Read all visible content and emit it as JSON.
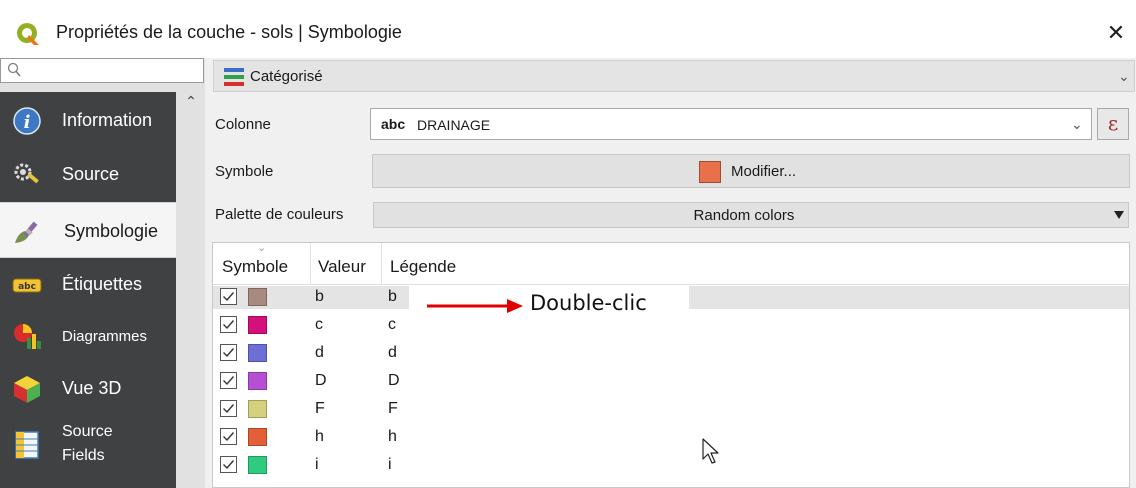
{
  "window": {
    "title": "Propriétés de la couche - sols | Symbologie",
    "close_glyph": "✕"
  },
  "sidebar": {
    "search_placeholder": "",
    "items": [
      {
        "label": "Information",
        "icon": "info-icon"
      },
      {
        "label": "Source",
        "icon": "source-wrench-icon"
      },
      {
        "label": "Symbologie",
        "icon": "paintbrush-icon",
        "selected": true
      },
      {
        "label": "Étiquettes",
        "icon": "abc-label-icon"
      },
      {
        "label": "Diagrammes",
        "icon": "pie-chart-icon"
      },
      {
        "label": "Vue 3D",
        "icon": "cube-icon"
      },
      {
        "label": "Source\nFields",
        "icon": "fields-table-icon"
      }
    ]
  },
  "renderer": {
    "label": "Catégorisé",
    "icon": "categorized-renderer-icon"
  },
  "form": {
    "column_label": "Colonne",
    "column_prefix": "abc",
    "column_value": "DRAINAGE",
    "expression_glyph": "ε",
    "symbol_label": "Symbole",
    "symbol_button": "Modifier...",
    "symbol_color": "#e8704a",
    "palette_label": "Palette de couleurs",
    "palette_value": "Random colors"
  },
  "table": {
    "headers": [
      "Symbole",
      "Valeur",
      "Légende"
    ],
    "rows": [
      {
        "value": "b",
        "legend": "b",
        "color": "#a88a80",
        "checked": true
      },
      {
        "value": "c",
        "legend": "c",
        "color": "#d4107a",
        "checked": true
      },
      {
        "value": "d",
        "legend": "d",
        "color": "#6d6ed6",
        "checked": true
      },
      {
        "value": "D",
        "legend": "D",
        "color": "#b550d4",
        "checked": true
      },
      {
        "value": "F",
        "legend": "F",
        "color": "#d4d07e",
        "checked": true
      },
      {
        "value": "h",
        "legend": "h",
        "color": "#e35f38",
        "checked": true
      },
      {
        "value": "i",
        "legend": "i",
        "color": "#2ecb80",
        "checked": true
      }
    ]
  },
  "annotation": {
    "text": "Double-clic",
    "arrow_color": "#e00000"
  }
}
